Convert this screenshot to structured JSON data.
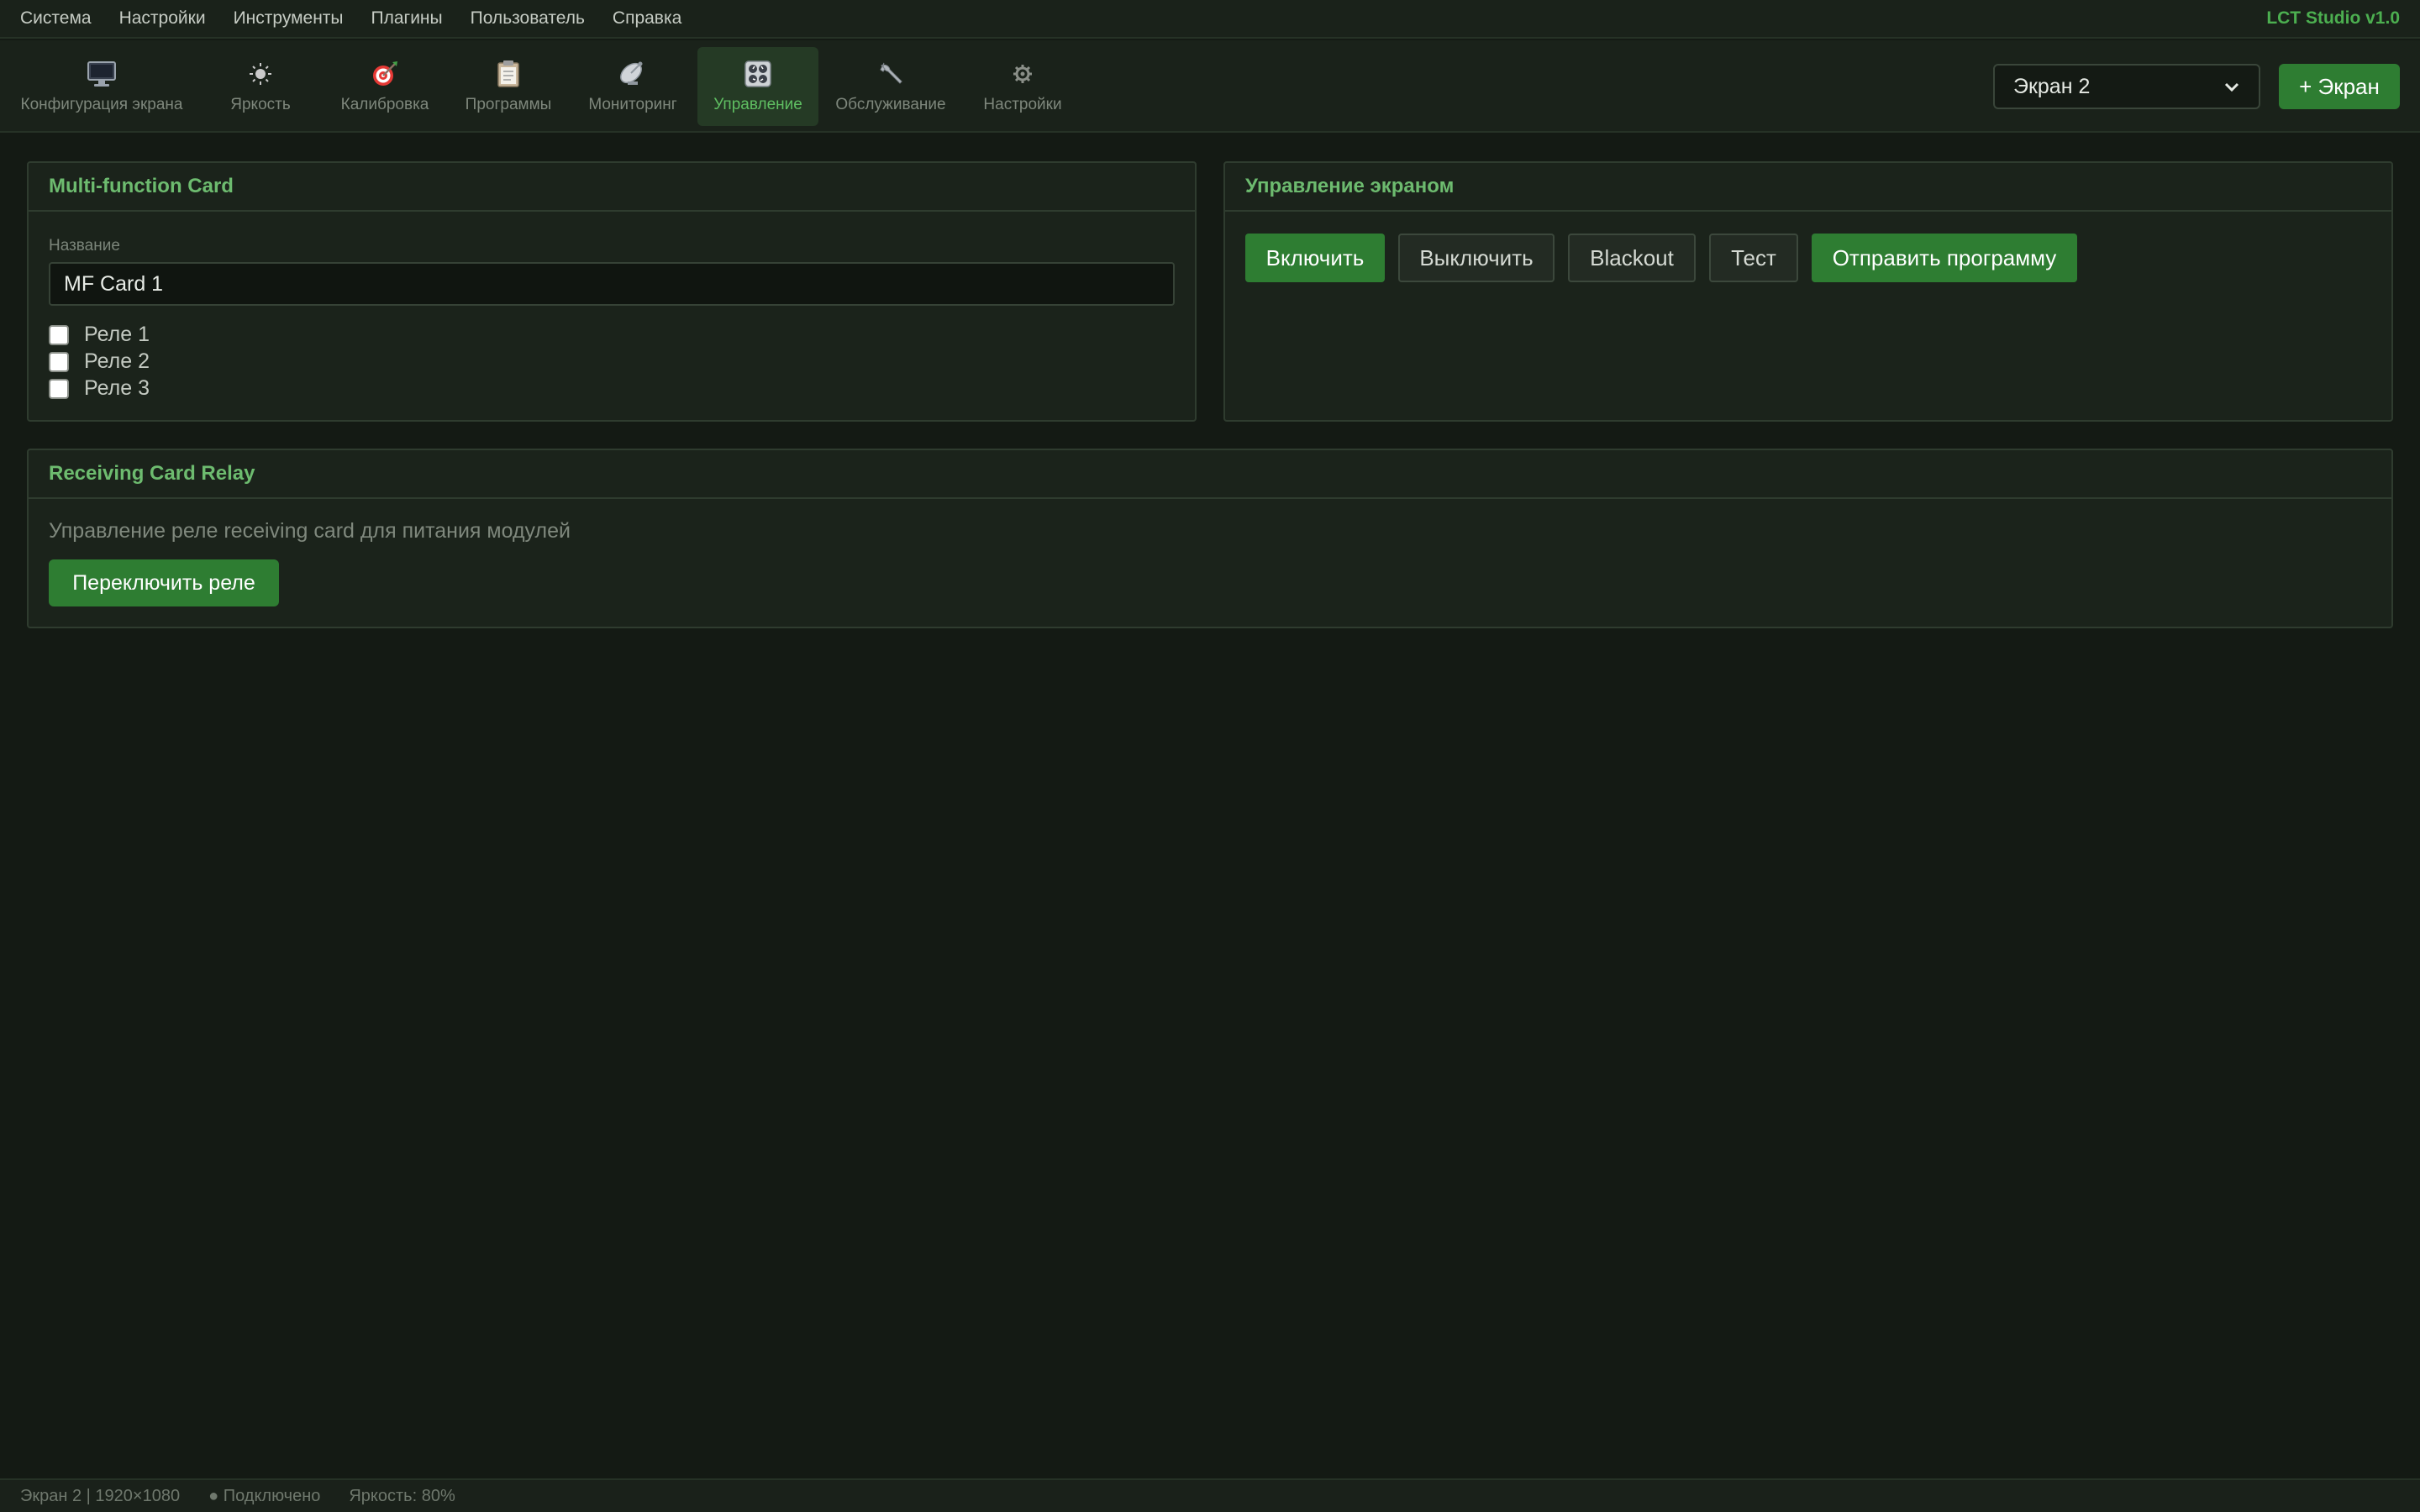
{
  "menubar": {
    "items": [
      "Система",
      "Настройки",
      "Инструменты",
      "Плагины",
      "Пользователь",
      "Справка"
    ],
    "app_version": "LCT Studio v1.0"
  },
  "toolbar": {
    "tools": [
      {
        "label": "Конфигурация экрана",
        "icon": "monitor-icon"
      },
      {
        "label": "Яркость",
        "icon": "sun-icon"
      },
      {
        "label": "Калибровка",
        "icon": "target-icon"
      },
      {
        "label": "Программы",
        "icon": "clipboard-icon"
      },
      {
        "label": "Мониторинг",
        "icon": "satellite-icon"
      },
      {
        "label": "Управление",
        "icon": "control-panel-icon",
        "active": true
      },
      {
        "label": "Обслуживание",
        "icon": "wrench-icon"
      },
      {
        "label": "Настройки",
        "icon": "gear-icon"
      }
    ],
    "screen_select": {
      "value": "Экран 2"
    },
    "add_screen_label": "+ Экран"
  },
  "multifunction_card": {
    "title": "Multi-function Card",
    "name_label": "Название",
    "name_value": "MF Card 1",
    "relays": [
      {
        "label": "Реле 1",
        "checked": false
      },
      {
        "label": "Реле 2",
        "checked": false
      },
      {
        "label": "Реле 3",
        "checked": false
      }
    ]
  },
  "screen_control": {
    "title": "Управление экраном",
    "buttons": {
      "on": "Включить",
      "off": "Выключить",
      "blackout": "Blackout",
      "test": "Тест",
      "send_program": "Отправить программу"
    }
  },
  "receiving_card_relay": {
    "title": "Receiving Card Relay",
    "description": "Управление реле receiving card для питания модулей",
    "toggle_label": "Переключить реле"
  },
  "statusbar": {
    "screen_info": "Экран 2 | 1920×1080",
    "connection": "● Подключено",
    "brightness": "Яркость: 80%"
  },
  "colors": {
    "accent": "#2e7d32",
    "accent_text": "#4caf50",
    "background": "#141a14",
    "panel": "#1b231b"
  }
}
